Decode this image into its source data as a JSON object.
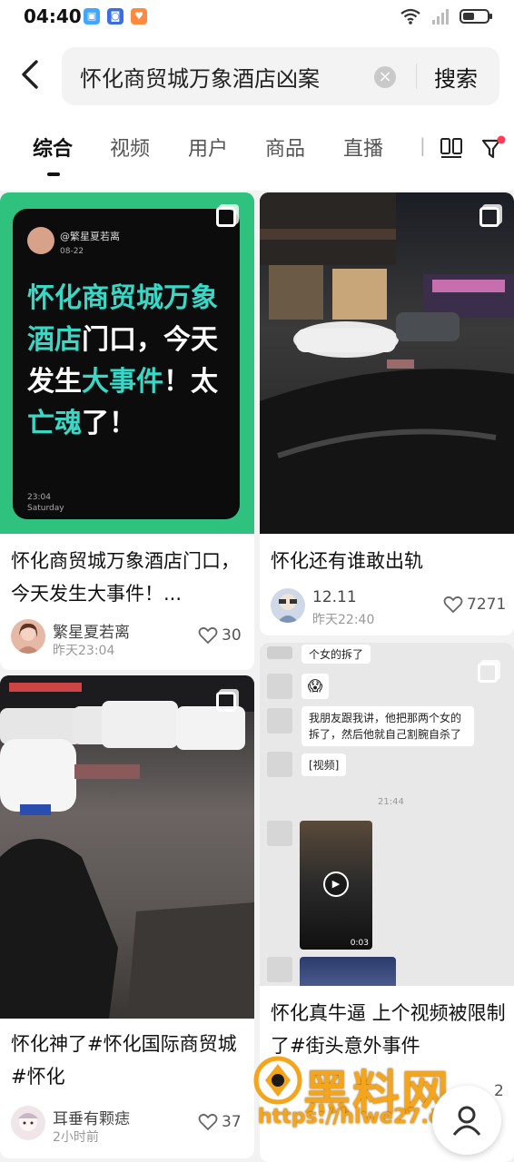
{
  "status_bar": {
    "time": "04:40"
  },
  "search": {
    "query": "怀化商贸城万象酒店凶案",
    "button_label": "搜索"
  },
  "tabs": [
    {
      "label": "综合",
      "active": true
    },
    {
      "label": "视频",
      "active": false
    },
    {
      "label": "用户",
      "active": false
    },
    {
      "label": "商品",
      "active": false
    },
    {
      "label": "直播",
      "active": false
    }
  ],
  "cards": [
    {
      "image": {
        "handle": "@繁星夏若离",
        "date": "08-22",
        "text_plain_1": "怀化商贸城万象酒店",
        "text_plain_2": "门口，今天发生",
        "text_teal_1": "大事件",
        "text_plain_3": "！太",
        "text_teal_2": "亡魂",
        "text_plain_4": "了！",
        "footer_time": "23:04",
        "footer_day": "Saturday"
      },
      "title": "怀化商贸城万象酒店门口，今天发生大事件！...",
      "author": "繁星夏若离",
      "time": "昨天23:04",
      "likes": "30"
    },
    {
      "title": "怀化还有谁敢出轨",
      "author": "12.11",
      "time": "昨天22:40",
      "likes": "7271"
    },
    {
      "title": "怀化神了#怀化国际商贸城 #怀化",
      "author": "耳垂有颗痣",
      "time": "2小时前",
      "likes": "37"
    },
    {
      "image": {
        "chat_1": "个女的拆了",
        "chat_2": "我朋友跟我讲，他把那两个女的拆了，然后他就自己割腕自杀了",
        "chat_3": "[视频]",
        "chat_time": "21:44",
        "video_duration": "0:03"
      },
      "title": "怀化真牛逼 上个视频被限制了#街头意外事件",
      "likes": "2"
    }
  ],
  "watermark": {
    "name": "黑料网",
    "url": "https://hlwe27.com"
  },
  "colors": {
    "accent_green": "#2ec27e",
    "teal_text": "#39d7c5",
    "filter_dot": "#ff3b5c",
    "watermark": "#f4a51c"
  }
}
